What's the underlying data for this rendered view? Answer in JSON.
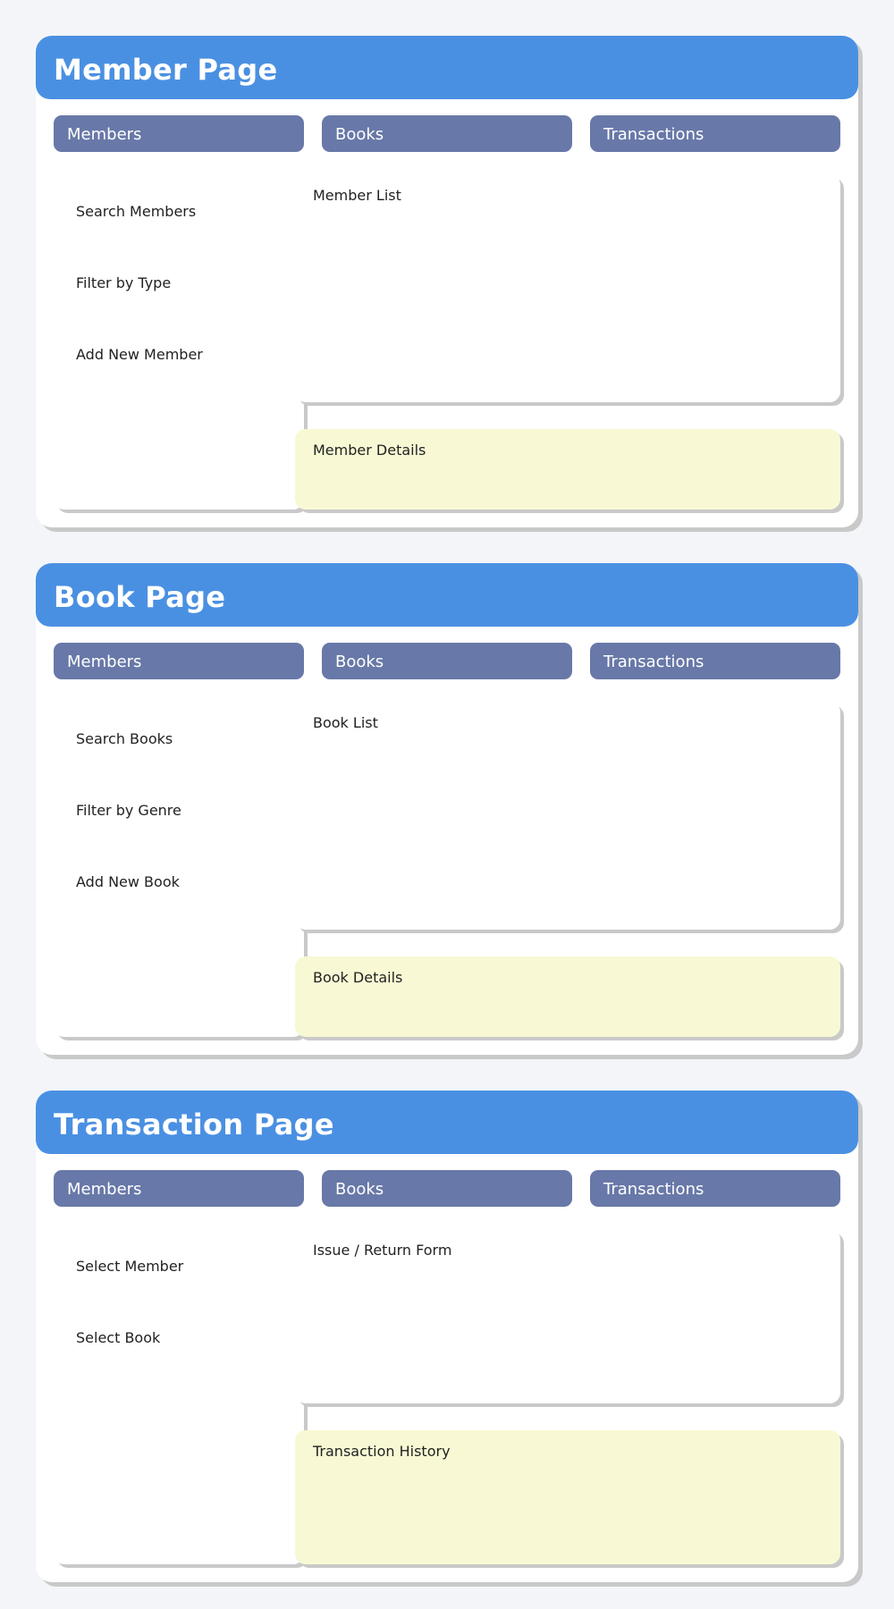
{
  "pages": [
    {
      "title": "Member Page",
      "tabs": [
        "Members",
        "Books",
        "Transactions"
      ],
      "sidebar": [
        "Search Members",
        "Filter by Type",
        "Add New Member"
      ],
      "main_panel": "Member List",
      "detail_panel": "Member Details"
    },
    {
      "title": "Book Page",
      "tabs": [
        "Members",
        "Books",
        "Transactions"
      ],
      "sidebar": [
        "Search Books",
        "Filter by Genre",
        "Add New Book"
      ],
      "main_panel": "Book List",
      "detail_panel": "Book Details"
    },
    {
      "title": "Transaction Page",
      "tabs": [
        "Members",
        "Books",
        "Transactions"
      ],
      "sidebar": [
        "Select Member",
        "Select Book"
      ],
      "main_panel": "Issue / Return Form",
      "detail_panel": "Transaction History"
    }
  ],
  "colors": {
    "header": "#4a90e2",
    "tab": "#6878a8",
    "detail_panel": "#f8f9d4",
    "background": "#f3f5f9"
  }
}
